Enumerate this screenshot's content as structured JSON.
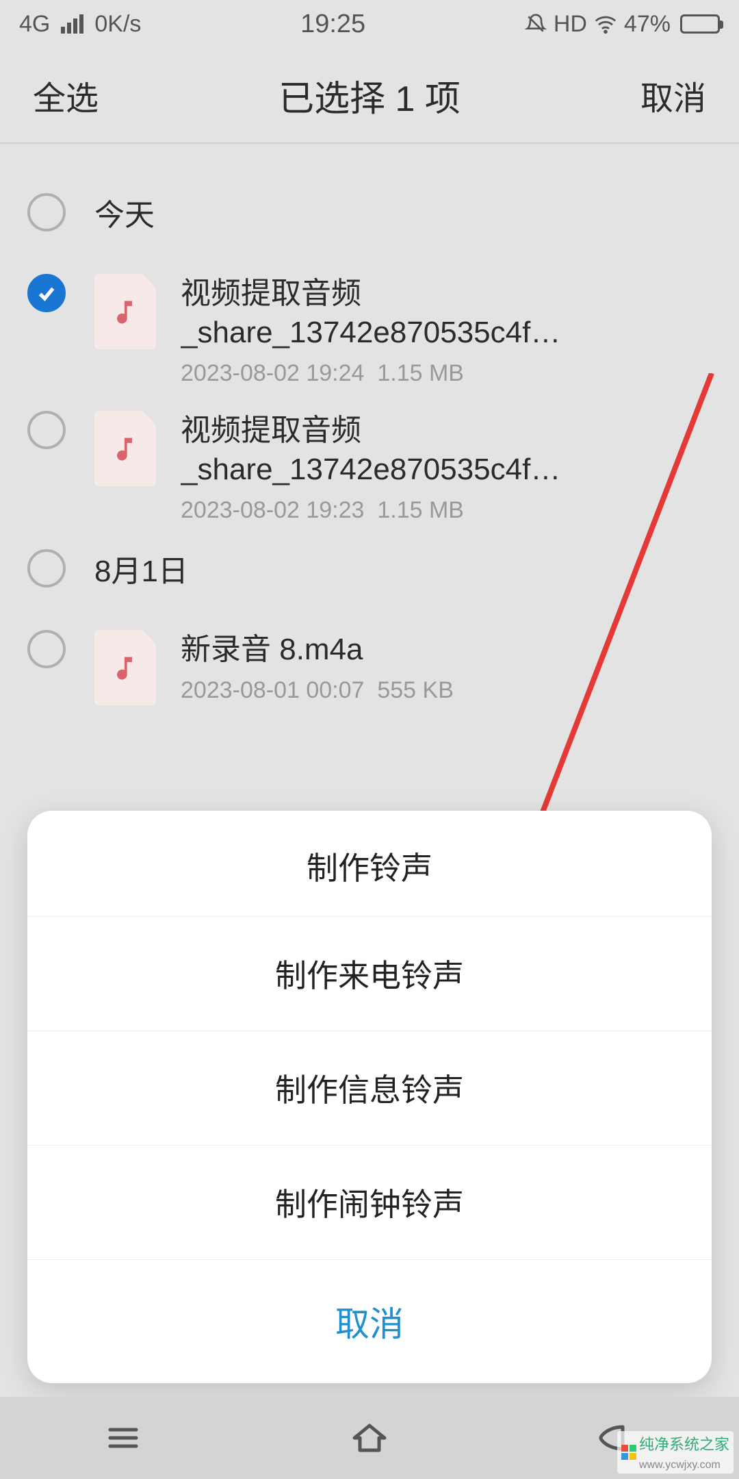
{
  "status": {
    "network": "4G",
    "speed": "0K/s",
    "time": "19:25",
    "hd": "HD",
    "battery_pct": "47%"
  },
  "header": {
    "select_all": "全选",
    "title": "已选择 1 项",
    "cancel": "取消"
  },
  "groups": [
    {
      "label": "今天",
      "checked": false
    },
    {
      "label": "8月1日",
      "checked": false
    }
  ],
  "files": [
    {
      "name": "视频提取音频_share_13742e870535c4f…",
      "datetime": "2023-08-02 19:24",
      "size": "1.15 MB",
      "checked": true
    },
    {
      "name": "视频提取音频_share_13742e870535c4f…",
      "datetime": "2023-08-02 19:23",
      "size": "1.15 MB",
      "checked": false
    },
    {
      "name": "新录音 8.m4a",
      "datetime": "2023-08-01 00:07",
      "size": "555 KB",
      "checked": false
    }
  ],
  "sheet": {
    "title": "制作铃声",
    "items": [
      "制作来电铃声",
      "制作信息铃声",
      "制作闹钟铃声"
    ],
    "cancel": "取消"
  },
  "watermark": {
    "text": "纯净系统之家",
    "url": "www.ycwjxy.com"
  }
}
